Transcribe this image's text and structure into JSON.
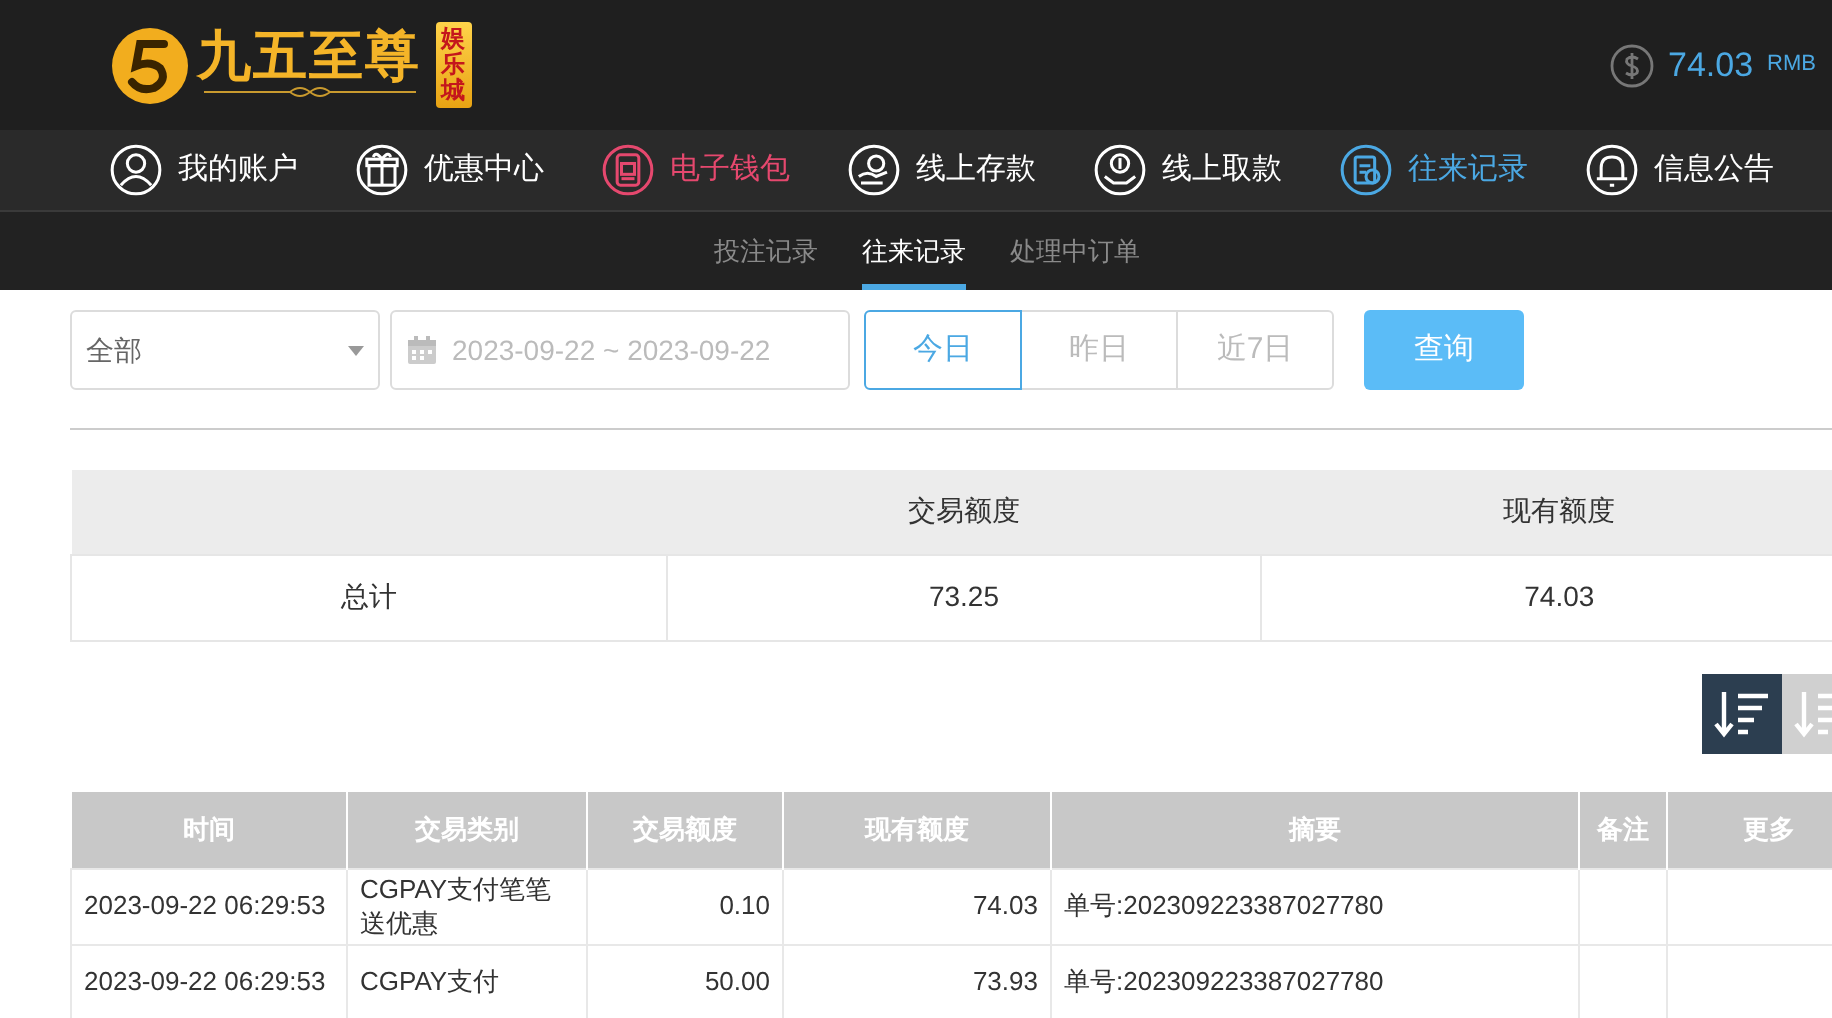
{
  "logo": {
    "title": "九五至尊",
    "badge": "娱乐城"
  },
  "balance": {
    "amount": "74.03",
    "currency": "RMB"
  },
  "nav": [
    {
      "label": "我的账户",
      "color": "#ffffff"
    },
    {
      "label": "优惠中心",
      "color": "#ffffff"
    },
    {
      "label": "电子钱包",
      "color": "#e5486e"
    },
    {
      "label": "线上存款",
      "color": "#ffffff"
    },
    {
      "label": "线上取款",
      "color": "#ffffff"
    },
    {
      "label": "往来记录",
      "color": "#4ba8e3"
    },
    {
      "label": "信息公告",
      "color": "#ffffff"
    }
  ],
  "subtabs": [
    {
      "label": "投注记录",
      "selected": false
    },
    {
      "label": "往来记录",
      "selected": true
    },
    {
      "label": "处理中订单",
      "selected": false
    }
  ],
  "filter": {
    "type_select": "全部",
    "date_range": "2023-09-22 ~ 2023-09-22",
    "ranges": [
      {
        "label": "今日",
        "selected": true
      },
      {
        "label": "昨日",
        "selected": false
      },
      {
        "label": "近7日",
        "selected": false
      }
    ],
    "query_button": "查询"
  },
  "summary": {
    "columns": [
      "",
      "交易额度",
      "现有额度"
    ],
    "row": [
      "总计",
      "73.25",
      "74.03"
    ]
  },
  "sort_buttons": [
    {
      "selected": true
    },
    {
      "selected": false
    }
  ],
  "table": {
    "columns": [
      "时间",
      "交易类别",
      "交易额度",
      "现有额度",
      "摘要",
      "备注",
      "更多"
    ],
    "rows": [
      [
        "2023-09-22 06:29:53",
        "CGPAY支付笔笔送优惠",
        "0.10",
        "74.03",
        "单号:202309223387027780",
        "",
        ""
      ],
      [
        "2023-09-22 06:29:53",
        "CGPAY支付",
        "50.00",
        "73.93",
        "单号:202309223387027780",
        "",
        ""
      ]
    ]
  }
}
